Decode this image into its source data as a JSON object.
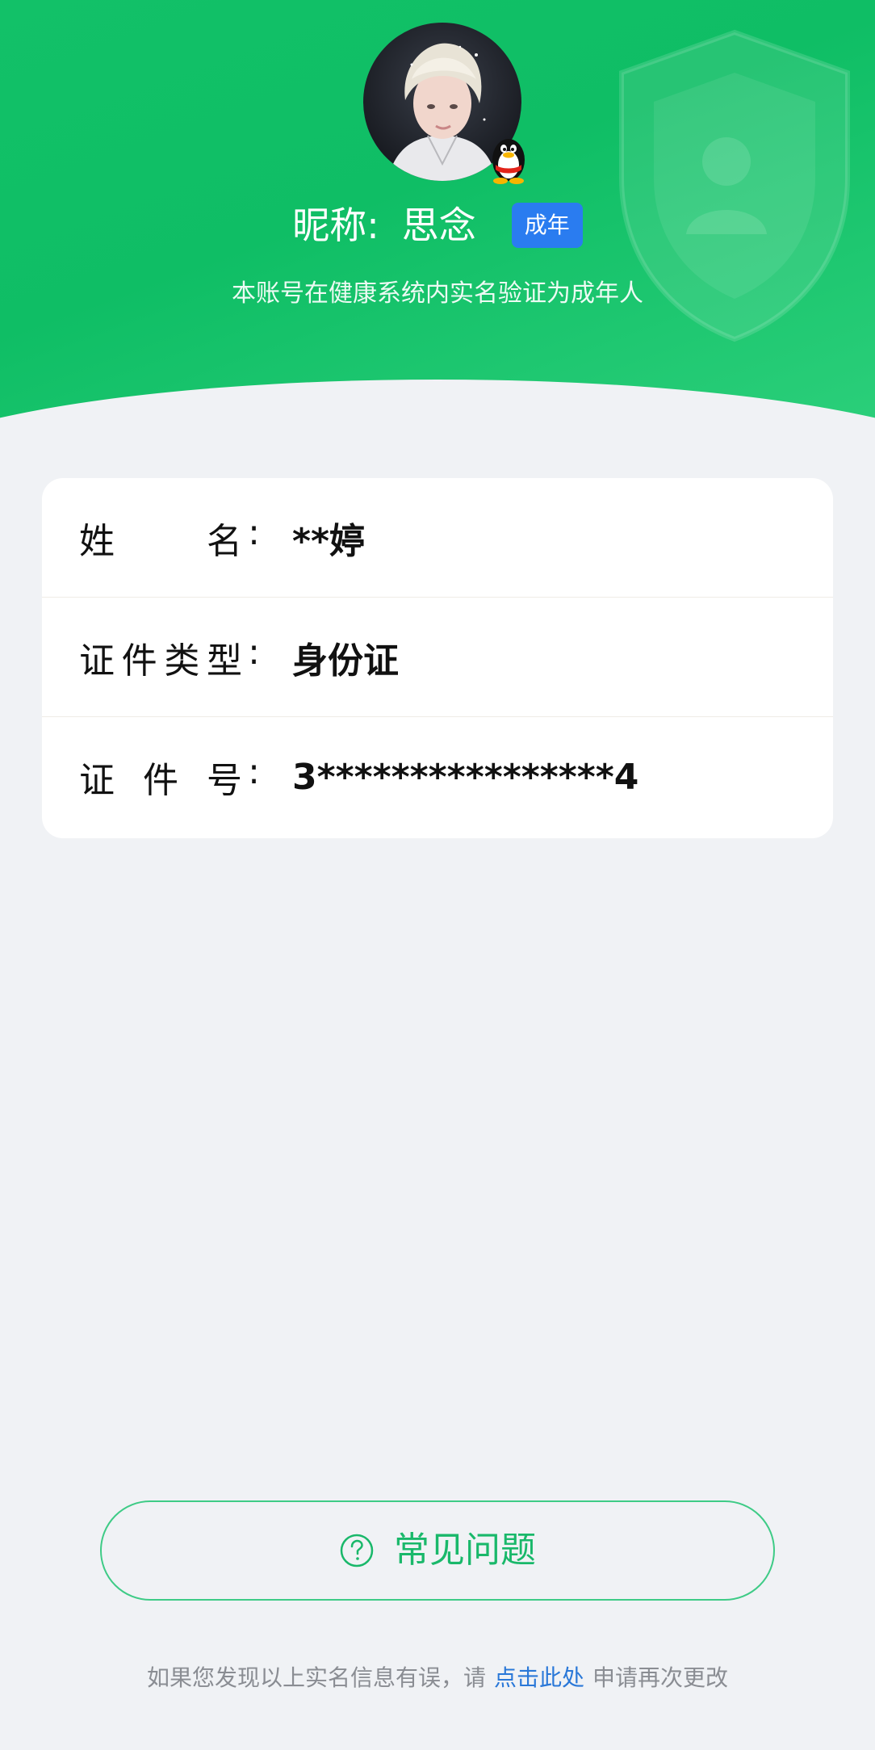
{
  "header": {
    "nickname_label": "昵称:",
    "nickname_value": "思念",
    "age_badge": "成年",
    "verify_text": "本账号在健康系统内实名验证为成年人"
  },
  "icons": {
    "avatar": "user-avatar-photo",
    "qq": "qq-penguin-icon",
    "shield": "shield-user-watermark",
    "faq": "question-circle-icon"
  },
  "info": {
    "rows": [
      {
        "label_chars": [
          "姓",
          "名"
        ],
        "value": "**婷"
      },
      {
        "label_chars": [
          "证",
          "件",
          "类",
          "型"
        ],
        "value": "身份证"
      },
      {
        "label_chars": [
          "证",
          "件",
          "号"
        ],
        "value": "3****************4"
      }
    ],
    "colon": ":"
  },
  "faq": {
    "label": "常见问题"
  },
  "footer": {
    "prefix": "如果您发现以上实名信息有误，请",
    "link": "点击此处",
    "suffix": "申请再次更改"
  },
  "colors": {
    "header_green": "#12c168",
    "accent_green": "#19b86a",
    "badge_blue": "#2a7cf0",
    "link_blue": "#2a78d8",
    "background": "#f0f2f5"
  }
}
